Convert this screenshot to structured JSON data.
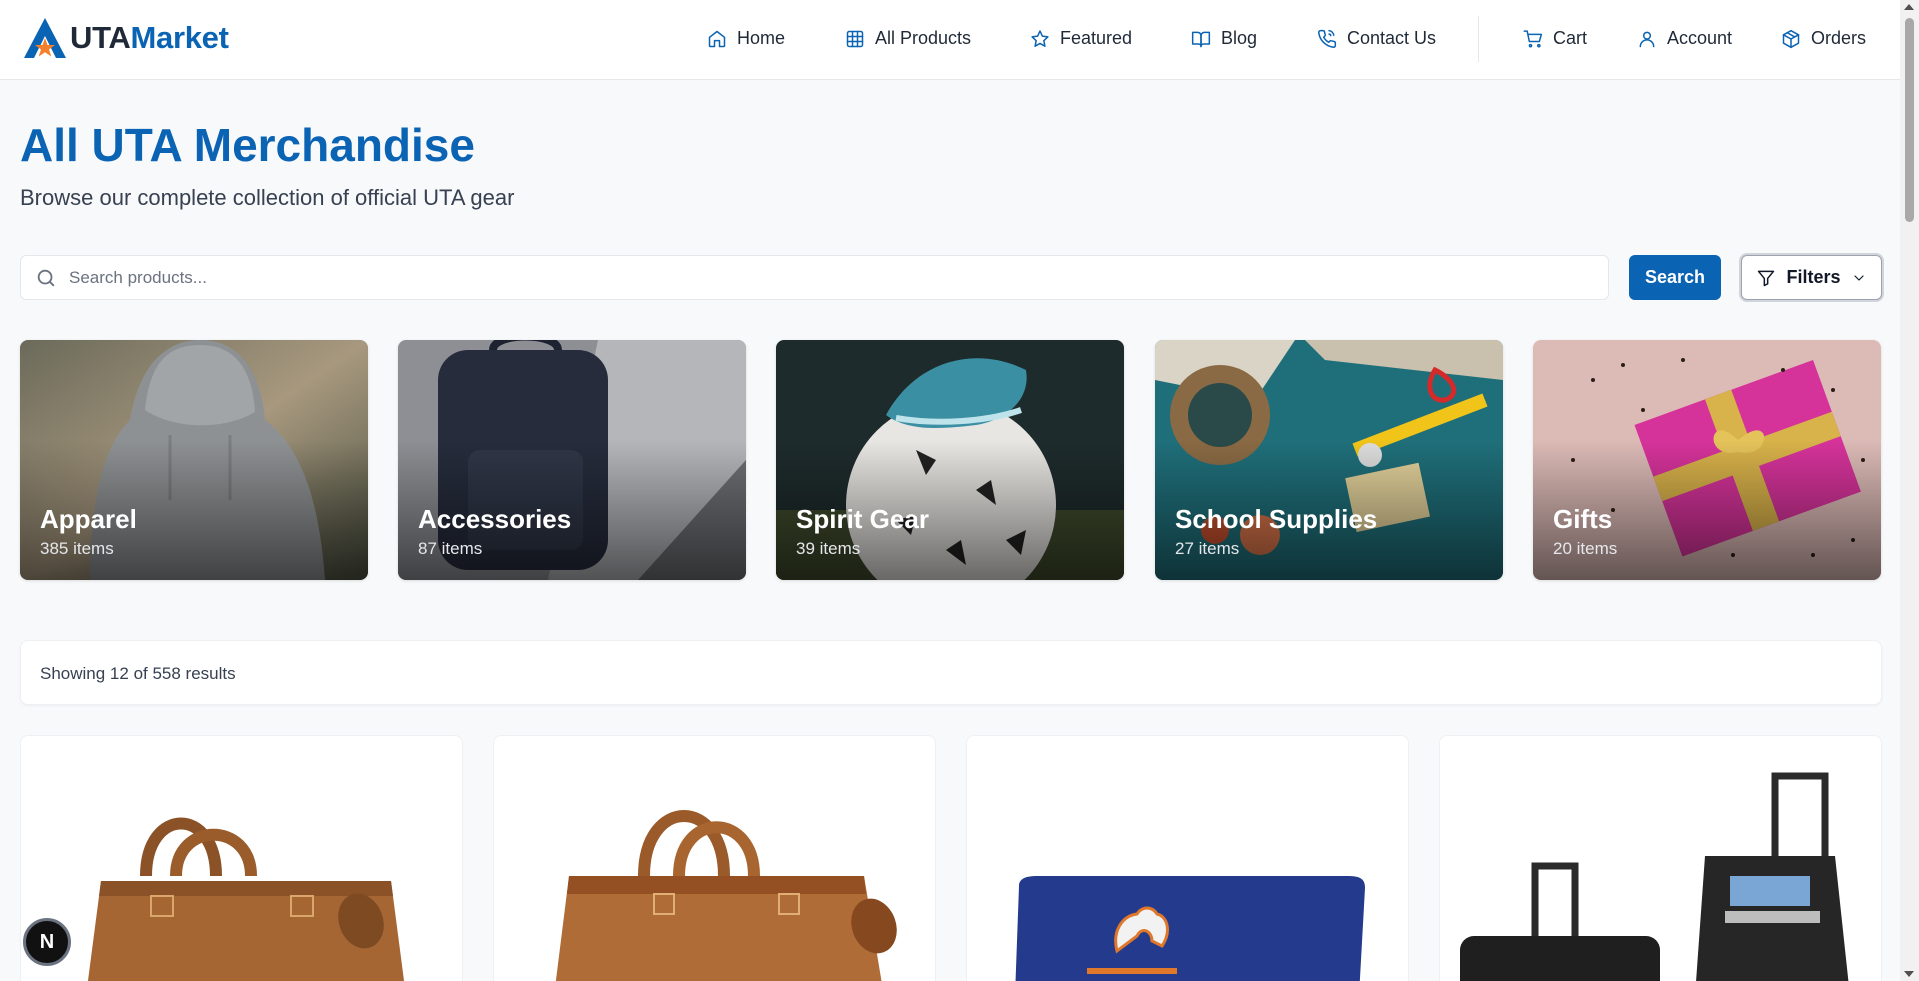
{
  "brand": {
    "part1": "UTA",
    "part2": "Market",
    "accent": "#0b63b3"
  },
  "nav": {
    "items": [
      {
        "label": "Home",
        "icon": "home-icon"
      },
      {
        "label": "All Products",
        "icon": "grid-icon"
      },
      {
        "label": "Featured",
        "icon": "star-icon"
      },
      {
        "label": "Blog",
        "icon": "book-icon"
      },
      {
        "label": "Contact Us",
        "icon": "phone-icon"
      },
      {
        "label": "Cart",
        "icon": "cart-icon"
      },
      {
        "label": "Account",
        "icon": "user-icon"
      },
      {
        "label": "Orders",
        "icon": "package-icon"
      }
    ]
  },
  "hero": {
    "title": "All UTA Merchandise",
    "subtitle": "Browse our complete collection of official UTA gear"
  },
  "search": {
    "placeholder": "Search products...",
    "value": "",
    "button_label": "Search",
    "filters_label": "Filters"
  },
  "categories": [
    {
      "name": "Apparel",
      "count": "385 items"
    },
    {
      "name": "Accessories",
      "count": "87 items"
    },
    {
      "name": "Spirit Gear",
      "count": "39 items"
    },
    {
      "name": "School Supplies",
      "count": "27 items"
    },
    {
      "name": "Gifts",
      "count": "20 items"
    }
  ],
  "results": {
    "text": "Showing 12 of 558 results"
  },
  "floating_badge": {
    "label": "N"
  }
}
